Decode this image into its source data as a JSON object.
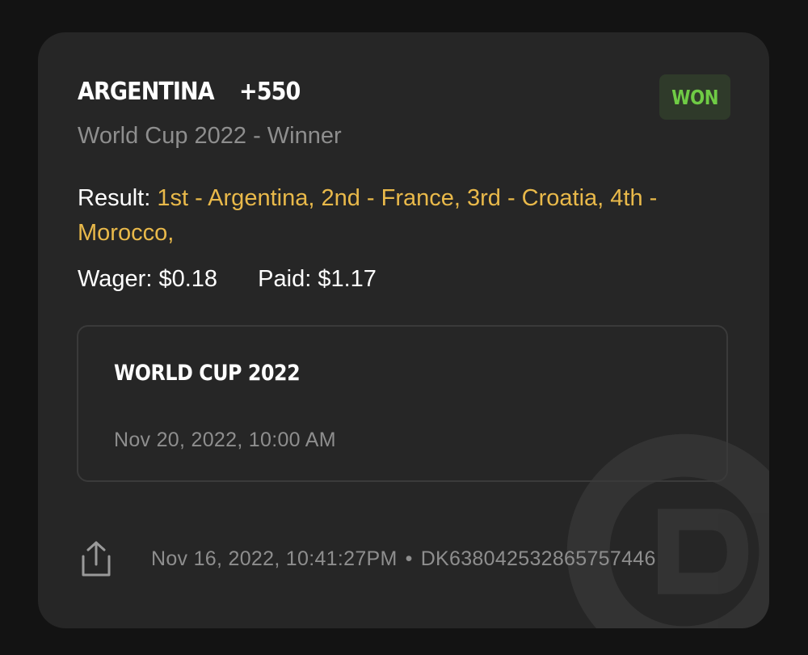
{
  "bet": {
    "team": "ARGENTINA",
    "odds": "+550",
    "status": "WON",
    "event": "World Cup 2022 - Winner",
    "result_label": "Result:",
    "result_value": "1st - Argentina, 2nd - France, 3rd - Croatia, 4th - Morocco,",
    "wager_label": "Wager:",
    "wager_value": "$0.18",
    "paid_label": "Paid:",
    "paid_value": "$1.17"
  },
  "event_card": {
    "title": "WORLD CUP 2022",
    "date": "Nov 20, 2022, 10:00 AM"
  },
  "footer": {
    "icon": "share-icon",
    "timestamp": "Nov 16, 2022, 10:41:27PM",
    "separator": "•",
    "bet_id": "DK638042532865757446"
  },
  "colors": {
    "background": "#131313",
    "card": "#262626",
    "won_text": "#6fcb45",
    "won_badge_bg": "#2f3a2a",
    "result_accent": "#e9b94a",
    "muted_text": "#8e8e8e"
  }
}
